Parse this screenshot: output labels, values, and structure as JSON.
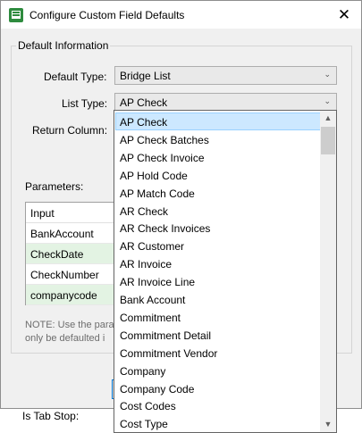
{
  "window": {
    "title": "Configure Custom Field Defaults",
    "close_glyph": "✕"
  },
  "group": {
    "title": "Default Information"
  },
  "fields": {
    "default_type": {
      "label": "Default Type:",
      "value": "Bridge List"
    },
    "list_type": {
      "label": "List Type:",
      "value": "AP Check"
    },
    "return_column": {
      "label": "Return Column:"
    }
  },
  "parameters": {
    "label": "Parameters:",
    "header": "Input",
    "rows": [
      {
        "text": "BankAccount",
        "highlighted": false
      },
      {
        "text": "CheckDate",
        "highlighted": true
      },
      {
        "text": "CheckNumber",
        "highlighted": false
      },
      {
        "text": "companycode",
        "highlighted": true
      }
    ],
    "highlight_color": "#e3f3e3"
  },
  "note": {
    "line1": "NOTE: Use the para",
    "line2": "only be defaulted i"
  },
  "tab_stop": {
    "label": "Is Tab Stop:"
  },
  "dropdown": {
    "selected_index": 0,
    "selection_color": "#cce8ff",
    "items": [
      "AP Check",
      "AP Check Batches",
      "AP Check Invoice",
      "AP Hold Code",
      "AP Match Code",
      "AR Check",
      "AR Check Invoices",
      "AR Customer",
      "AR Invoice",
      "AR Invoice Line",
      "Bank Account",
      "Commitment",
      "Commitment Detail",
      "Commitment Vendor",
      "Company",
      "Company Code",
      "Cost Codes",
      "Cost Type"
    ]
  },
  "icons": {
    "app": "form-app-icon",
    "close": "close-icon",
    "combo_arrow": "chevron-down-icon",
    "scroll_up": "scroll-up-icon",
    "scroll_down": "scroll-down-icon"
  }
}
